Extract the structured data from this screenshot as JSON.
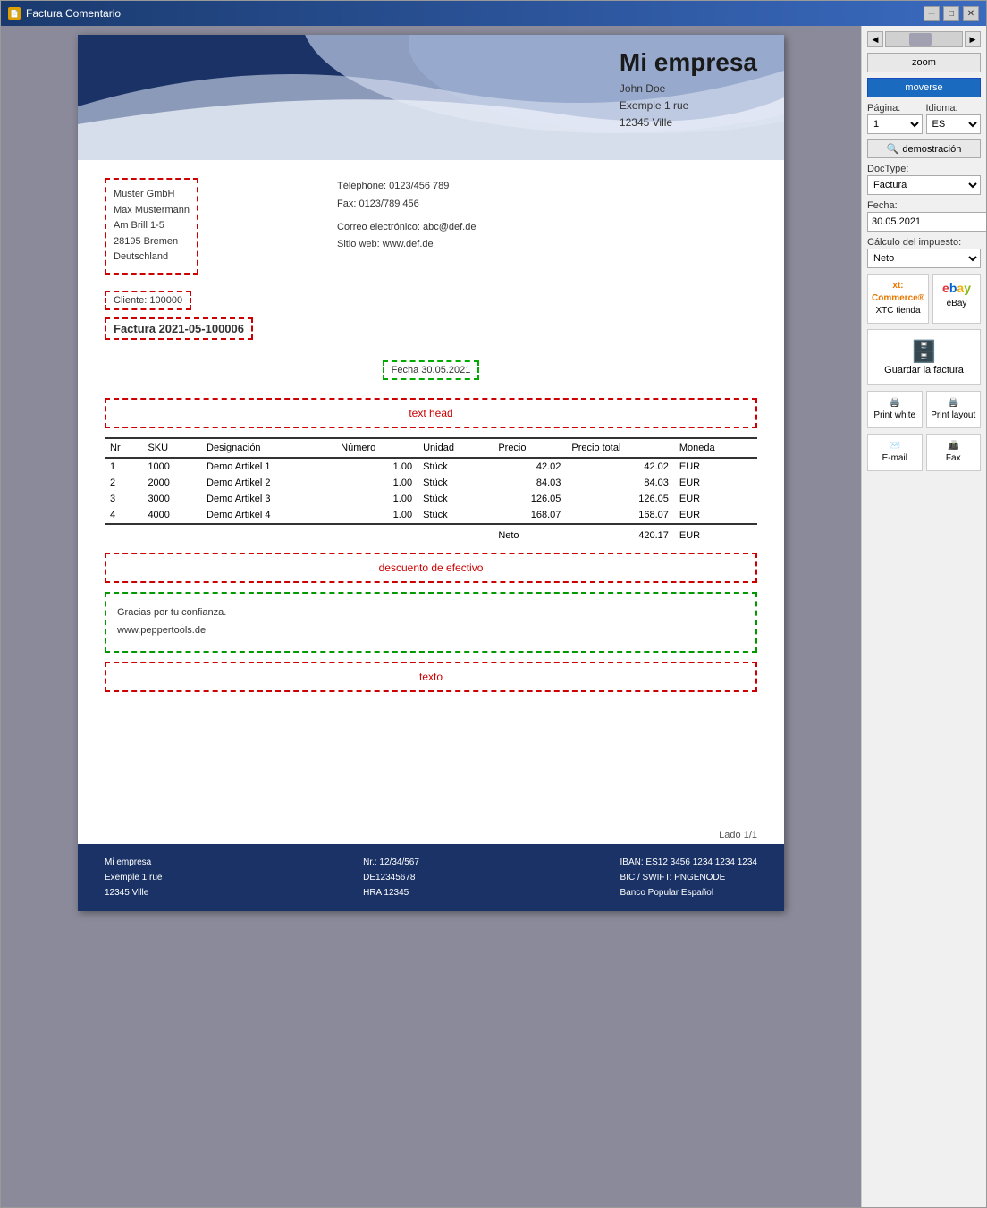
{
  "window": {
    "title": "Factura Comentario"
  },
  "sidebar": {
    "zoom_label": "zoom",
    "move_label": "moverse",
    "page_label": "Página:",
    "language_label": "Idioma:",
    "page_value": "1",
    "language_value": "ES",
    "search_btn": "demostración",
    "doctype_label": "DocType:",
    "doctype_value": "Factura",
    "fecha_label": "Fecha:",
    "fecha_value": "30.05.2021",
    "tax_label": "Cálculo del impuesto:",
    "tax_value": "Neto",
    "xtc_label": "XTC tienda",
    "ebay_label": "eBay",
    "save_label": "Guardar la factura",
    "print_white_label": "Print white",
    "print_layout_label": "Print layout",
    "email_label": "E-mail",
    "fax_label": "Fax"
  },
  "invoice": {
    "company_name": "Mi empresa",
    "contact_name": "John Doe",
    "contact_address": "Exemple 1 rue",
    "contact_city": "12345 Ville",
    "phone": "Téléphone: 0123/456 789",
    "fax": "Fax: 0123/789 456",
    "email": "Correo electrónico: abc@def.de",
    "website": "Sitio web: www.def.de",
    "recipient_line1": "Muster GmbH",
    "recipient_line2": "Max Mustermann",
    "recipient_line3": "Am Brill 1-5",
    "recipient_line4": "28195 Bremen",
    "recipient_line5": "Deutschland",
    "client_id": "Cliente: 100000",
    "invoice_num": "Factura 2021-05-100006",
    "invoice_date": "Fecha 30.05.2021",
    "text_head": "text head",
    "table_headers": [
      "Nr",
      "SKU",
      "Designación",
      "Número",
      "Unidad",
      "Precio",
      "Precio total",
      "Moneda"
    ],
    "table_rows": [
      {
        "nr": "1",
        "sku": "1000",
        "desc": "Demo Artikel 1",
        "qty": "1.00",
        "unit": "Stück",
        "price": "42.02",
        "total": "42.02",
        "currency": "EUR"
      },
      {
        "nr": "2",
        "sku": "2000",
        "desc": "Demo Artikel 2",
        "qty": "1.00",
        "unit": "Stück",
        "price": "84.03",
        "total": "84.03",
        "currency": "EUR"
      },
      {
        "nr": "3",
        "sku": "3000",
        "desc": "Demo Artikel 3",
        "qty": "1.00",
        "unit": "Stück",
        "price": "126.05",
        "total": "126.05",
        "currency": "EUR"
      },
      {
        "nr": "4",
        "sku": "4000",
        "desc": "Demo Artikel 4",
        "qty": "1.00",
        "unit": "Stück",
        "price": "168.07",
        "total": "168.07",
        "currency": "EUR"
      }
    ],
    "neto_label": "Neto",
    "neto_value": "420.17",
    "neto_currency": "EUR",
    "discount_text": "descuento de efectivo",
    "thank_you_line1": "Gracias por tu confianza.",
    "thank_you_line2": "www.peppertools.de",
    "texto": "texto",
    "page_indicator": "Lado 1/1",
    "footer_col1_line1": "Mi empresa",
    "footer_col1_line2": "Exemple 1 rue",
    "footer_col1_line3": "12345 Ville",
    "footer_col2_line1": "Nr.: 12/34/567",
    "footer_col2_line2": "DE12345678",
    "footer_col2_line3": "HRA 12345",
    "footer_col3_line1": "IBAN: ES12 3456 1234 1234 1234",
    "footer_col3_line2": "BIC / SWIFT: PNGENODE",
    "footer_col3_line3": "Banco Popular Español"
  }
}
